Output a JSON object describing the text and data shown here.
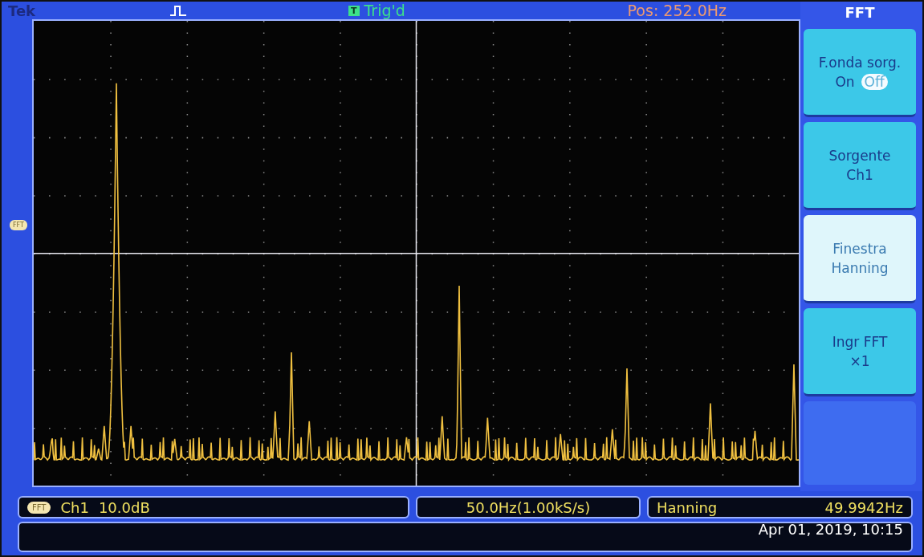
{
  "top_bar": {
    "brand": "Tek",
    "trigger_badge": "T",
    "trigger_status": "Trig'd",
    "position": "Pos: 252.0Hz"
  },
  "trace_marker": "FFT",
  "menu": {
    "title": "FFT",
    "items": [
      {
        "kind": "toggle",
        "label": "F.onda sorg.",
        "options": [
          {
            "label": "On",
            "selected": false
          },
          {
            "label": "Off",
            "selected": true
          }
        ],
        "selected": false
      },
      {
        "kind": "value",
        "label": "Sorgente",
        "value": "Ch1",
        "selected": false
      },
      {
        "kind": "value",
        "label": "Finestra",
        "value": "Hanning",
        "selected": true
      },
      {
        "kind": "value",
        "label": "Ingr FFT",
        "value": "×1",
        "selected": false
      }
    ]
  },
  "status_bar": {
    "badge": "FFT",
    "channel": "Ch1",
    "scale": "10.0dB",
    "timebase": "50.0Hz(1.00kS/s)",
    "window": "Hanning",
    "frequency": "49.9942Hz",
    "datetime": "Apr 01, 2019, 10:15"
  }
}
